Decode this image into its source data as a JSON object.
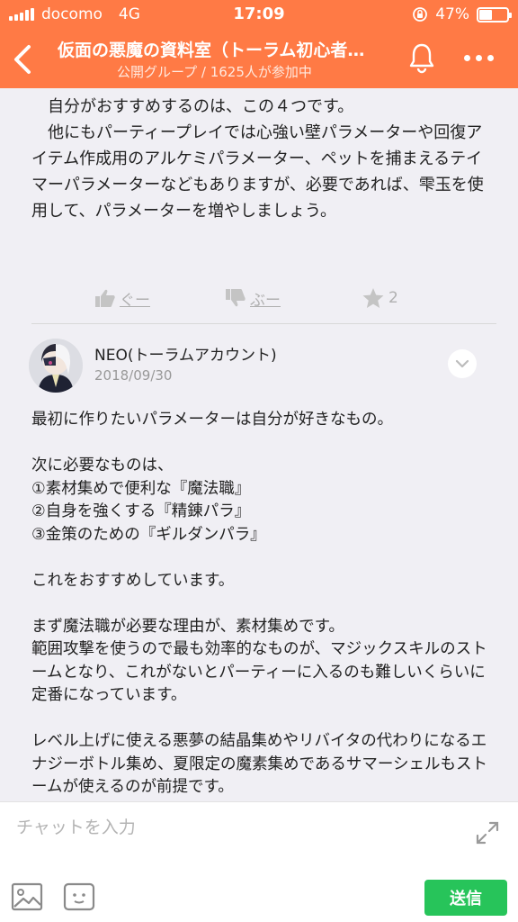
{
  "status_bar": {
    "carrier": "docomo",
    "network": "4G",
    "time": "17:09",
    "battery_percent": "47%",
    "battery_level": 0.47
  },
  "header": {
    "title": "仮面の悪魔の資料室（トーラム初心者…",
    "subtitle": "公開グループ / 1625人が参加中"
  },
  "previous_post": {
    "paragraphs": [
      "自分がおすすめするのは、この４つです。",
      "他にもパーティープレイでは心強い壁パラメーターや回復アイテム作成用のアルケミパラメーター、ペットを捕まえるテイマーパラメーターなどもありますが、必要であれば、雫玉を使用して、パラメーターを増やしましょう。"
    ],
    "reactions": {
      "like_label": "ぐー",
      "dislike_label": "ぶー",
      "star_count": "2"
    }
  },
  "post": {
    "author": "NEO(トーラムアカウント)",
    "date": "2018/09/30",
    "lines": [
      "最初に作りたいパラメーターは自分が好きなもの。",
      "",
      "次に必要なものは、",
      "①素材集めで便利な『魔法職』",
      "②自身を強くする『精錬パラ』",
      "③金策のための『ギルダンパラ』",
      "",
      "これをおすすめしています。",
      "",
      "まず魔法職が必要な理由が、素材集めです。",
      "範囲攻撃を使うので最も効率的なものが、マジックスキルのストームとなり、これがないとパーティーに入るのも難しいくらいに定番になっています。",
      "",
      "レベル上げに使える悪夢の結晶集めやリバイタの代わりになるエナジーボトル集め、夏限定の魔素集めであるサマーシェルもストームが使えるのが前提です。"
    ]
  },
  "input_bar": {
    "placeholder": "チャットを入力",
    "send_label": "送信"
  },
  "colors": {
    "header": "#ff7a45",
    "send": "#27c45a",
    "background": "#f0eff4"
  }
}
